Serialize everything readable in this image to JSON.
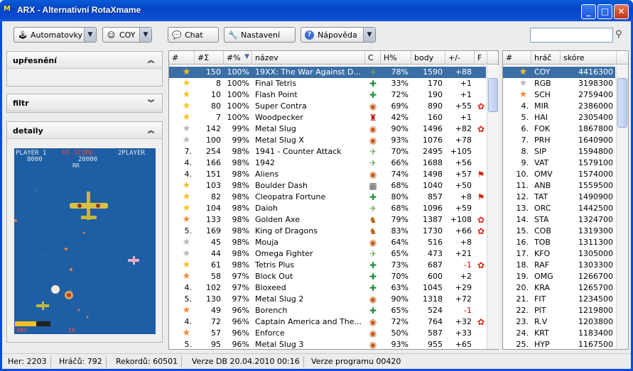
{
  "window": {
    "title": "ARX - Alternativní RotaXmame",
    "icon": "app-logo-icon"
  },
  "toolbar": {
    "mode_label": "Automatovky",
    "user_label": "COY",
    "chat_label": "Chat",
    "settings_label": "Nastavení",
    "help_label": "Nápověda",
    "search_placeholder": ""
  },
  "sidebar": {
    "refine_title": "upřesnění",
    "filter_title": "filtr",
    "detail_title": "detaily"
  },
  "preview": {
    "player1": "PLAYER 1",
    "p1score": "8000",
    "hiscore_label": "HI-SCORE",
    "hiscore": "20000",
    "player2": "2PLAYER",
    "rr": "RR",
    "bottom_left": "WAY",
    "bottom_mid": "18"
  },
  "games_table": {
    "columns": [
      "#",
      "#Σ",
      "#%",
      "název",
      "C",
      "H%",
      "body",
      "+/-",
      "F"
    ],
    "rows": [
      {
        "rank": "",
        "cnt": "150",
        "pct": "100%",
        "name": "19XX: The War Against D...",
        "h": "78%",
        "body": "1590",
        "pm": "+88",
        "star": "gold",
        "ctrl": "plane",
        "flag": "",
        "selected": true
      },
      {
        "rank": "",
        "cnt": "8",
        "pct": "100%",
        "name": "Final Tetris",
        "h": "33%",
        "body": "170",
        "pm": "+1",
        "star": "gold",
        "ctrl": "puzzle",
        "flag": ""
      },
      {
        "rank": "",
        "cnt": "10",
        "pct": "100%",
        "name": "Flash Point",
        "h": "72%",
        "body": "190",
        "pm": "+1",
        "star": "gold",
        "ctrl": "puzzle",
        "flag": ""
      },
      {
        "rank": "",
        "cnt": "80",
        "pct": "100%",
        "name": "Super Contra",
        "h": "69%",
        "body": "890",
        "pm": "+55",
        "star": "gold",
        "ctrl": "shield",
        "flag": "ribbon"
      },
      {
        "rank": "",
        "cnt": "7",
        "pct": "100%",
        "name": "Woodpecker",
        "h": "42%",
        "body": "160",
        "pm": "+1",
        "star": "gold",
        "ctrl": "robot",
        "flag": ""
      },
      {
        "rank": "",
        "cnt": "142",
        "pct": "99%",
        "name": "Metal Slug",
        "h": "90%",
        "body": "1496",
        "pm": "+82",
        "star": "silver",
        "ctrl": "shield",
        "flag": "ribbon"
      },
      {
        "rank": "",
        "cnt": "100",
        "pct": "99%",
        "name": "Metal Slug X",
        "h": "93%",
        "body": "1076",
        "pm": "+78",
        "star": "silver",
        "ctrl": "shield",
        "flag": ""
      },
      {
        "rank": "7.",
        "cnt": "254",
        "pct": "98%",
        "name": "1941 - Counter Attack",
        "h": "70%",
        "body": "2495",
        "pm": "+105",
        "star": "",
        "ctrl": "plane",
        "flag": ""
      },
      {
        "rank": "4.",
        "cnt": "166",
        "pct": "98%",
        "name": "1942",
        "h": "66%",
        "body": "1688",
        "pm": "+56",
        "star": "",
        "ctrl": "plane",
        "flag": ""
      },
      {
        "rank": "4.",
        "cnt": "151",
        "pct": "98%",
        "name": "Aliens",
        "h": "74%",
        "body": "1498",
        "pm": "+57",
        "star": "",
        "ctrl": "shield",
        "flag": "pennant"
      },
      {
        "rank": "",
        "cnt": "103",
        "pct": "98%",
        "name": "Boulder Dash",
        "h": "68%",
        "body": "1040",
        "pm": "+50",
        "star": "gold",
        "ctrl": "maze",
        "flag": ""
      },
      {
        "rank": "",
        "cnt": "82",
        "pct": "98%",
        "name": "Cleopatra Fortune",
        "h": "80%",
        "body": "857",
        "pm": "+8",
        "star": "gold",
        "ctrl": "puzzle",
        "flag": "pennant"
      },
      {
        "rank": "",
        "cnt": "104",
        "pct": "98%",
        "name": "Daioh",
        "h": "68%",
        "body": "1096",
        "pm": "+59",
        "star": "gold",
        "ctrl": "plane",
        "flag": ""
      },
      {
        "rank": "",
        "cnt": "133",
        "pct": "98%",
        "name": "Golden Axe",
        "h": "79%",
        "body": "1387",
        "pm": "+108",
        "star": "orange",
        "ctrl": "fighter",
        "flag": "ribbon"
      },
      {
        "rank": "5.",
        "cnt": "169",
        "pct": "98%",
        "name": "King of Dragons",
        "h": "83%",
        "body": "1730",
        "pm": "+66",
        "star": "",
        "ctrl": "fighter",
        "flag": "ribbon"
      },
      {
        "rank": "",
        "cnt": "45",
        "pct": "98%",
        "name": "Mouja",
        "h": "64%",
        "body": "516",
        "pm": "+8",
        "star": "silver",
        "ctrl": "shield",
        "flag": ""
      },
      {
        "rank": "",
        "cnt": "44",
        "pct": "98%",
        "name": "Omega Fighter",
        "h": "65%",
        "body": "473",
        "pm": "+21",
        "star": "silver",
        "ctrl": "plane",
        "flag": ""
      },
      {
        "rank": "",
        "cnt": "61",
        "pct": "98%",
        "name": "Tetris Plus",
        "h": "73%",
        "body": "687",
        "pm": "-1",
        "star": "gold",
        "ctrl": "puzzle",
        "flag": "ribbon"
      },
      {
        "rank": "",
        "cnt": "58",
        "pct": "97%",
        "name": "Block Out",
        "h": "70%",
        "body": "600",
        "pm": "+2",
        "star": "orange",
        "ctrl": "puzzle",
        "flag": ""
      },
      {
        "rank": "4.",
        "cnt": "102",
        "pct": "97%",
        "name": "Bloxeed",
        "h": "63%",
        "body": "1045",
        "pm": "+29",
        "star": "",
        "ctrl": "puzzle",
        "flag": ""
      },
      {
        "rank": "5.",
        "cnt": "130",
        "pct": "97%",
        "name": "Metal Slug 2",
        "h": "90%",
        "body": "1318",
        "pm": "+72",
        "star": "",
        "ctrl": "shield",
        "flag": ""
      },
      {
        "rank": "",
        "cnt": "49",
        "pct": "96%",
        "name": "Borench",
        "h": "65%",
        "body": "524",
        "pm": "-1",
        "star": "orange",
        "ctrl": "puzzle",
        "flag": ""
      },
      {
        "rank": "4.",
        "cnt": "72",
        "pct": "96%",
        "name": "Captain America and The...",
        "h": "72%",
        "body": "764",
        "pm": "+32",
        "star": "",
        "ctrl": "shield",
        "flag": "ribbon"
      },
      {
        "rank": "",
        "cnt": "57",
        "pct": "96%",
        "name": "Enforce",
        "h": "50%",
        "body": "587",
        "pm": "+33",
        "star": "orange",
        "ctrl": "shield",
        "flag": ""
      },
      {
        "rank": "5.",
        "cnt": "95",
        "pct": "96%",
        "name": "Metal Slug 3",
        "h": "93%",
        "body": "955",
        "pm": "+65",
        "star": "",
        "ctrl": "shield",
        "flag": ""
      }
    ]
  },
  "players_table": {
    "columns": [
      "#",
      "hráč",
      "skóre"
    ],
    "rows": [
      {
        "rank": "",
        "name": "COY",
        "score": "4416300",
        "star": "gold",
        "selected": true
      },
      {
        "rank": "",
        "name": "RGB",
        "score": "3198300",
        "star": "silver"
      },
      {
        "rank": "",
        "name": "SCH",
        "score": "2759400",
        "star": "orange"
      },
      {
        "rank": "4.",
        "name": "MIR",
        "score": "2386000",
        "star": ""
      },
      {
        "rank": "5.",
        "name": "HAI",
        "score": "2305400",
        "star": ""
      },
      {
        "rank": "6.",
        "name": "FOK",
        "score": "1867800",
        "star": ""
      },
      {
        "rank": "7.",
        "name": "PRH",
        "score": "1640900",
        "star": ""
      },
      {
        "rank": "8.",
        "name": "SIP",
        "score": "1594800",
        "star": ""
      },
      {
        "rank": "9.",
        "name": "VAT",
        "score": "1579100",
        "star": ""
      },
      {
        "rank": "10.",
        "name": "OMV",
        "score": "1574000",
        "star": ""
      },
      {
        "rank": "11.",
        "name": "ANB",
        "score": "1559500",
        "star": ""
      },
      {
        "rank": "12.",
        "name": "TAT",
        "score": "1490900",
        "star": ""
      },
      {
        "rank": "13.",
        "name": "ORC",
        "score": "1442500",
        "star": ""
      },
      {
        "rank": "14.",
        "name": "STA",
        "score": "1324700",
        "star": ""
      },
      {
        "rank": "15.",
        "name": "COB",
        "score": "1319300",
        "star": ""
      },
      {
        "rank": "16.",
        "name": "TOB",
        "score": "1311300",
        "star": ""
      },
      {
        "rank": "17.",
        "name": "KFO",
        "score": "1305000",
        "star": ""
      },
      {
        "rank": "18.",
        "name": "RAF",
        "score": "1303300",
        "star": ""
      },
      {
        "rank": "19.",
        "name": "OMG",
        "score": "1266700",
        "star": ""
      },
      {
        "rank": "20.",
        "name": "KRA",
        "score": "1265700",
        "star": ""
      },
      {
        "rank": "21.",
        "name": "FIT",
        "score": "1234500",
        "star": ""
      },
      {
        "rank": "22.",
        "name": "PIT",
        "score": "1219800",
        "star": ""
      },
      {
        "rank": "23.",
        "name": "R.V",
        "score": "1203800",
        "star": ""
      },
      {
        "rank": "24.",
        "name": "KRT",
        "score": "1183400",
        "star": ""
      },
      {
        "rank": "25.",
        "name": "HYP",
        "score": "1167500",
        "star": ""
      }
    ]
  },
  "status": {
    "games": "Her: 2203",
    "players": "Hráčů: 792",
    "records": "Rekordů: 60501",
    "db_version": "Verze DB 20.04.2010 00:16",
    "app_version": "Verze programu 00420"
  },
  "colors": {
    "title_blue": "#0a4dd3",
    "selection": "#3a6ea5",
    "negative": "#d00000",
    "star_gold": "#f4c21c",
    "star_silver": "#b8b8b8",
    "star_orange": "#f08a3a"
  }
}
